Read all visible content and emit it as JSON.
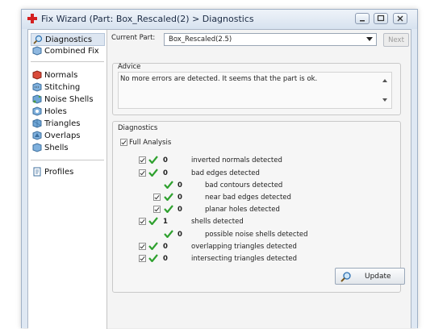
{
  "window": {
    "title": "Fix Wizard (Part: Box_Rescaled(2) > Diagnostics"
  },
  "sidebar": {
    "items": [
      {
        "label": "Diagnostics",
        "icon": "magnifier-icon",
        "selected": true
      },
      {
        "label": "Combined Fix",
        "icon": "combined-fix-icon"
      },
      {
        "label": "Normals",
        "icon": "normals-icon"
      },
      {
        "label": "Stitching",
        "icon": "stitching-icon"
      },
      {
        "label": "Noise Shells",
        "icon": "noise-shells-icon"
      },
      {
        "label": "Holes",
        "icon": "holes-icon"
      },
      {
        "label": "Triangles",
        "icon": "triangles-icon"
      },
      {
        "label": "Overlaps",
        "icon": "overlaps-icon"
      },
      {
        "label": "Shells",
        "icon": "shells-icon"
      },
      {
        "label": "Profiles",
        "icon": "profiles-icon"
      }
    ]
  },
  "header": {
    "current_part_label": "Current Part:",
    "current_part_value": "Box_Rescaled(2.5)",
    "next_label": "Next"
  },
  "advice": {
    "title": "Advice",
    "text": "No more errors are detected. It seems that the part is ok."
  },
  "diagnostics": {
    "title": "Diagnostics",
    "full_analysis_label": "Full Analysis",
    "full_analysis_checked": true,
    "rows": [
      {
        "count": "0",
        "label": "inverted normals detected",
        "checkbox": true
      },
      {
        "count": "0",
        "label": "bad edges detected",
        "checkbox": true
      },
      {
        "count": "0",
        "label": "bad contours detected",
        "checkbox": false
      },
      {
        "count": "0",
        "label": "near bad edges detected",
        "checkbox": true
      },
      {
        "count": "0",
        "label": "planar holes detected",
        "checkbox": true
      },
      {
        "count": "1",
        "label": "shells detected",
        "checkbox": true
      },
      {
        "count": "0",
        "label": "possible noise shells detected",
        "checkbox": false
      },
      {
        "count": "0",
        "label": "overlapping triangles detected",
        "checkbox": true
      },
      {
        "count": "0",
        "label": "intersecting triangles detected",
        "checkbox": true
      }
    ],
    "update_label": "Update"
  },
  "colors": {
    "ok_tick": "#2fa12f",
    "title_icon": "#d42020"
  }
}
